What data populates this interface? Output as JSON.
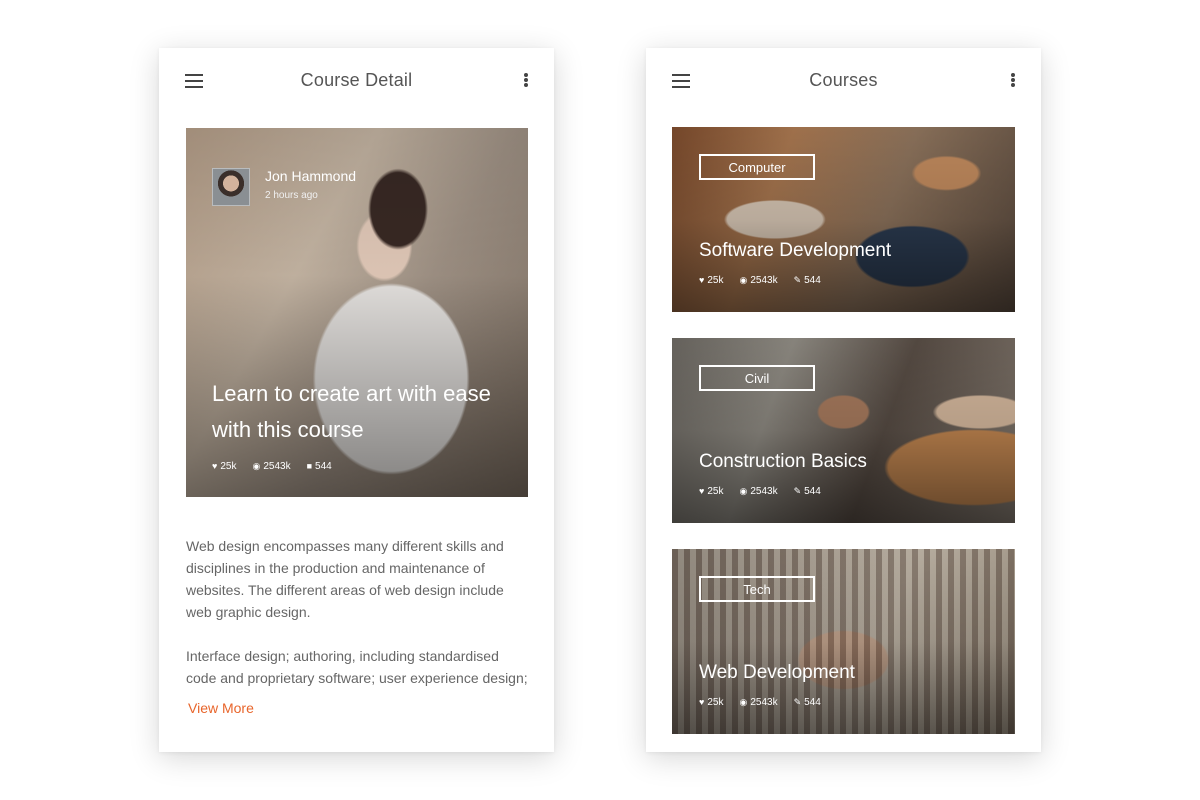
{
  "detail": {
    "title": "Course Detail",
    "author": {
      "name": "Jon Hammond",
      "time": "2 hours ago"
    },
    "hero_title": "Learn to create art with ease with this course",
    "stats": {
      "likes": "25k",
      "views": "2543k",
      "comments": "544"
    },
    "paragraphs": [
      "Web design encompasses many different skills and disciplines in the production and maintenance of websites. The different areas of web design include web graphic design.",
      "Interface design; authoring, including standardised code and proprietary software; user experience design;"
    ],
    "view_more": "View More"
  },
  "courses": {
    "title": "Courses",
    "items": [
      {
        "tag": "Computer",
        "title": "Software Development",
        "likes": "25k",
        "views": "2543k",
        "edits": "544"
      },
      {
        "tag": "Civil",
        "title": "Construction Basics",
        "likes": "25k",
        "views": "2543k",
        "edits": "544"
      },
      {
        "tag": "Tech",
        "title": "Web Development",
        "likes": "25k",
        "views": "2543k",
        "edits": "544"
      }
    ]
  },
  "icons": {
    "menu": "hamburger-icon",
    "more": "more-vertical-icon",
    "like": "heart-icon",
    "view": "eye-icon",
    "comment": "comment-icon",
    "edit": "pencil-icon"
  },
  "colors": {
    "accent": "#e8652b",
    "title_text": "#555555",
    "body_text": "#666666"
  }
}
